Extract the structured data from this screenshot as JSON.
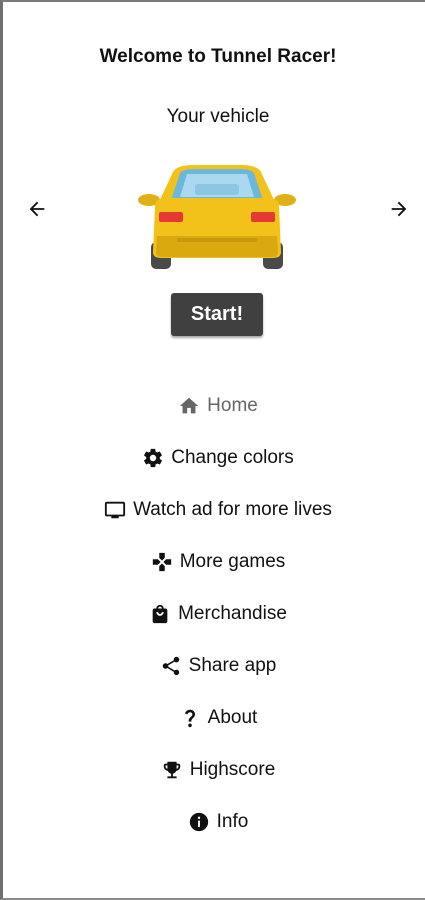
{
  "header": {
    "title": "Welcome to Tunnel Racer!",
    "subtitle": "Your vehicle"
  },
  "vehicle_picker": {
    "prev_icon": "arrow-left-icon",
    "next_icon": "arrow-right-icon",
    "vehicle_icon": "yellow-car-icon",
    "car_color": "#f2c21b",
    "start_label": "Start!"
  },
  "menu": {
    "items": [
      {
        "label": "Home",
        "icon": "home-icon"
      },
      {
        "label": "Change colors",
        "icon": "gear-icon"
      },
      {
        "label": "Watch ad for more lives",
        "icon": "tv-icon"
      },
      {
        "label": "More games",
        "icon": "gamepad-icon"
      },
      {
        "label": "Merchandise",
        "icon": "shopping-bag-icon"
      },
      {
        "label": "Share app",
        "icon": "share-icon"
      },
      {
        "label": "About",
        "icon": "question-icon"
      },
      {
        "label": "Highscore",
        "icon": "trophy-icon"
      },
      {
        "label": "Info",
        "icon": "info-icon"
      }
    ]
  }
}
